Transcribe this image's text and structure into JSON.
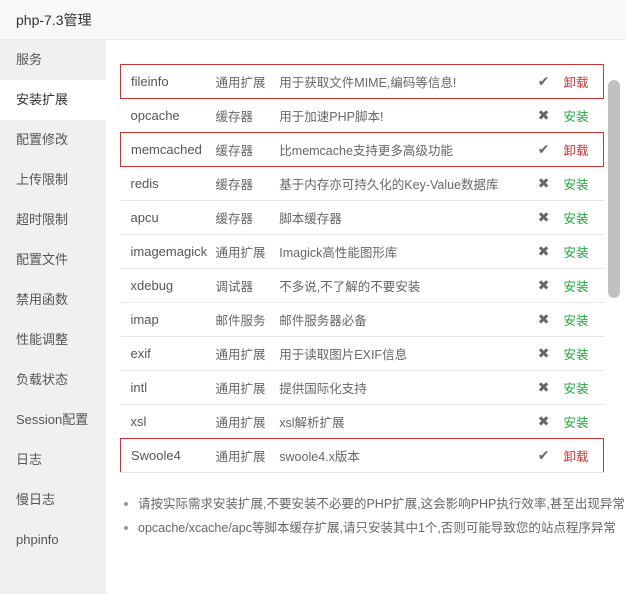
{
  "window": {
    "title": "php-7.3管理"
  },
  "sidebar": {
    "items": [
      {
        "label": "服务"
      },
      {
        "label": "安装扩展"
      },
      {
        "label": "配置修改"
      },
      {
        "label": "上传限制"
      },
      {
        "label": "超时限制"
      },
      {
        "label": "配置文件"
      },
      {
        "label": "禁用函数"
      },
      {
        "label": "性能调整"
      },
      {
        "label": "负载状态"
      },
      {
        "label": "Session配置"
      },
      {
        "label": "日志"
      },
      {
        "label": "慢日志"
      },
      {
        "label": "phpinfo"
      }
    ],
    "active_index": 1
  },
  "extensions": [
    {
      "name": "fileinfo",
      "type": "通用扩展",
      "desc": "用于获取文件MIME,编码等信息!",
      "status_icon": "✔",
      "action": "卸载",
      "installed": true
    },
    {
      "name": "opcache",
      "type": "缓存器",
      "desc": "用于加速PHP脚本!",
      "status_icon": "✖",
      "action": "安装",
      "installed": false
    },
    {
      "name": "memcached",
      "type": "缓存器",
      "desc": "比memcache支持更多高级功能",
      "status_icon": "✔",
      "action": "卸载",
      "installed": true
    },
    {
      "name": "redis",
      "type": "缓存器",
      "desc": "基于内存亦可持久化的Key-Value数据库",
      "status_icon": "✖",
      "action": "安装",
      "installed": false
    },
    {
      "name": "apcu",
      "type": "缓存器",
      "desc": "脚本缓存器",
      "status_icon": "✖",
      "action": "安装",
      "installed": false
    },
    {
      "name": "imagemagick",
      "type": "通用扩展",
      "desc": "Imagick高性能图形库",
      "status_icon": "✖",
      "action": "安装",
      "installed": false
    },
    {
      "name": "xdebug",
      "type": "调试器",
      "desc": "不多说,不了解的不要安装",
      "status_icon": "✖",
      "action": "安装",
      "installed": false
    },
    {
      "name": "imap",
      "type": "邮件服务",
      "desc": "邮件服务器必备",
      "status_icon": "✖",
      "action": "安装",
      "installed": false
    },
    {
      "name": "exif",
      "type": "通用扩展",
      "desc": "用于读取图片EXIF信息",
      "status_icon": "✖",
      "action": "安装",
      "installed": false
    },
    {
      "name": "intl",
      "type": "通用扩展",
      "desc": "提供国际化支持",
      "status_icon": "✖",
      "action": "安装",
      "installed": false
    },
    {
      "name": "xsl",
      "type": "通用扩展",
      "desc": "xsl解析扩展",
      "status_icon": "✖",
      "action": "安装",
      "installed": false
    },
    {
      "name": "Swoole4",
      "type": "通用扩展",
      "desc": "swoole4.x版本",
      "status_icon": "✔",
      "action": "卸载",
      "installed": true
    }
  ],
  "notes": [
    "请按实际需求安装扩展,不要安装不必要的PHP扩展,这会影响PHP执行效率,甚至出现异常",
    "opcache/xcache/apc等脚本缓存扩展,请只安装其中1个,否则可能导致您的站点程序异常"
  ],
  "colors": {
    "install": "#20a53a",
    "uninstall": "#cc3333",
    "highlight_border": "#cc3333"
  }
}
